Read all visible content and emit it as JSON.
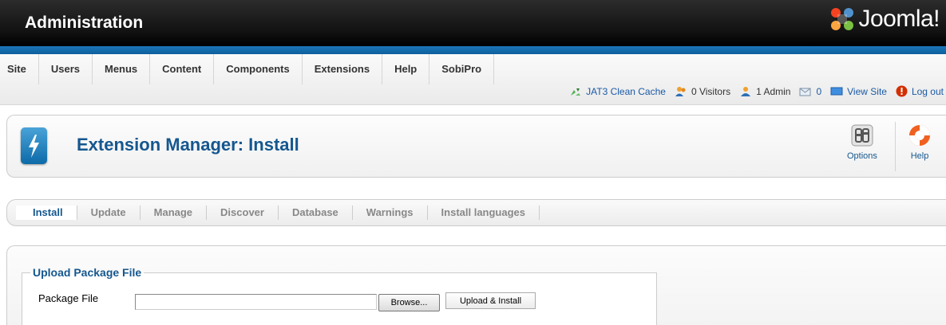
{
  "header": {
    "title": "Administration",
    "logo_text": "Joomla!"
  },
  "menu": {
    "items": [
      {
        "label": "Site"
      },
      {
        "label": "Users"
      },
      {
        "label": "Menus"
      },
      {
        "label": "Content"
      },
      {
        "label": "Components"
      },
      {
        "label": "Extensions"
      },
      {
        "label": "Help"
      },
      {
        "label": "SobiPro"
      }
    ]
  },
  "status": {
    "cache_label": "JAT3 Clean Cache",
    "visitors_label": "0 Visitors",
    "admin_label": "1 Admin",
    "messages_count": "0",
    "view_site_label": "View Site",
    "logout_label": "Log out"
  },
  "toolbar": {
    "page_title": "Extension Manager: Install",
    "options_label": "Options",
    "help_label": "Help"
  },
  "submenu": {
    "items": [
      {
        "label": "Install",
        "active": true
      },
      {
        "label": "Update"
      },
      {
        "label": "Manage"
      },
      {
        "label": "Discover"
      },
      {
        "label": "Database"
      },
      {
        "label": "Warnings"
      },
      {
        "label": "Install languages"
      }
    ]
  },
  "upload": {
    "legend": "Upload Package File",
    "package_label": "Package File",
    "file_value": "",
    "browse_label": "Browse...",
    "upload_label": "Upload & Install"
  },
  "colors": {
    "accent_blue": "#15578f",
    "header_strip": "#1a76b8",
    "logout_red": "#d32f00"
  }
}
